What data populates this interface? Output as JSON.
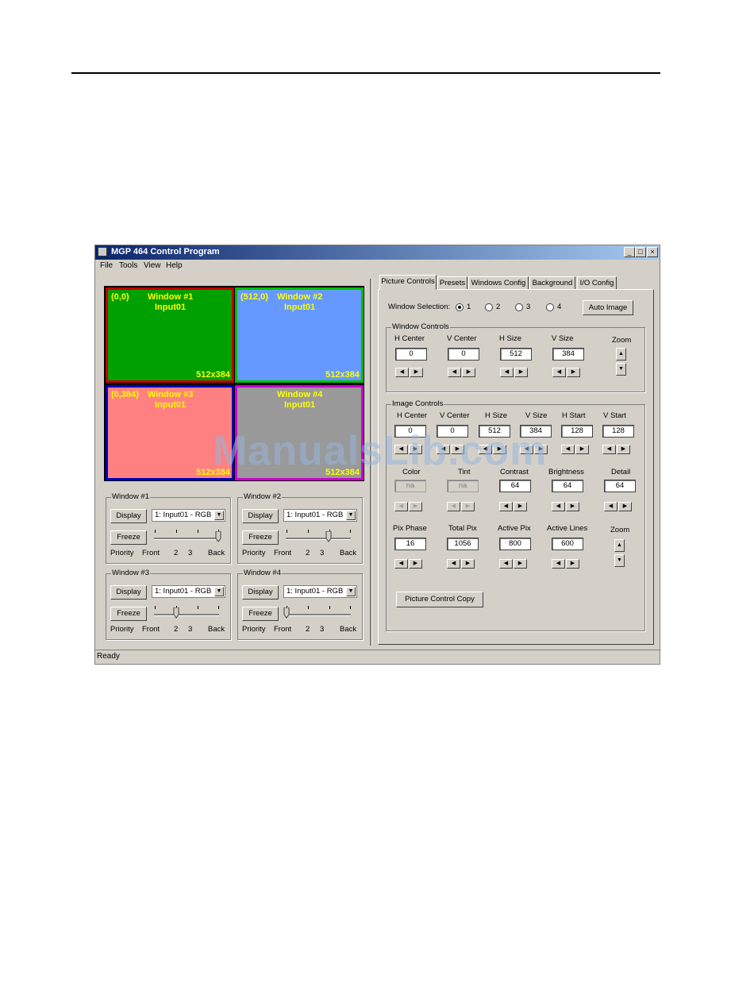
{
  "window": {
    "title": "MGP 464 Control Program",
    "controls": {
      "minimize": "_",
      "maximize": "□",
      "close": "×"
    }
  },
  "menu": [
    "File",
    "Tools",
    "View",
    "Help"
  ],
  "preview": {
    "panes": [
      {
        "coord": "(0,0)",
        "title": "Window #1",
        "input": "Input01",
        "size": "512x384",
        "fill": "#00a000",
        "border": "#c00000"
      },
      {
        "coord": "(512,0)",
        "title": "Window #2",
        "input": "Input01",
        "size": "512x384",
        "fill": "#6699ff",
        "border": "#00c000"
      },
      {
        "coord": "(0,384)",
        "title": "Window #3",
        "input": "Input01",
        "size": "512x384",
        "fill": "#ff8080",
        "border": "#0000c0"
      },
      {
        "coord": "",
        "title": "Window #4",
        "input": "Input01",
        "size": "512x384",
        "fill": "#999999",
        "border": "#cc00cc"
      }
    ]
  },
  "window_groups": [
    {
      "label": "Window #1",
      "display": "Display",
      "combo": "1: Input01 - RGB",
      "freeze": "Freeze",
      "priority": "Priority",
      "front": "Front",
      "p2": "2",
      "p3": "3",
      "back": "Back",
      "priority_level": 4
    },
    {
      "label": "Window #2",
      "display": "Display",
      "combo": "1: Input01 - RGB",
      "freeze": "Freeze",
      "priority": "Priority",
      "front": "Front",
      "p2": "2",
      "p3": "3",
      "back": "Back",
      "priority_level": 3
    },
    {
      "label": "Window #3",
      "display": "Display",
      "combo": "1: Input01 - RGB",
      "freeze": "Freeze",
      "priority": "Priority",
      "front": "Front",
      "p2": "2",
      "p3": "3",
      "back": "Back",
      "priority_level": 2
    },
    {
      "label": "Window #4",
      "display": "Display",
      "combo": "1: Input01 - RGB",
      "freeze": "Freeze",
      "priority": "Priority",
      "front": "Front",
      "p2": "2",
      "p3": "3",
      "back": "Back",
      "priority_level": 1
    }
  ],
  "tabs": [
    "Picture Controls",
    "Presets",
    "Windows Config",
    "Background",
    "I/O Config"
  ],
  "window_selection": {
    "label": "Window Selection:",
    "options": [
      "1",
      "2",
      "3",
      "4"
    ],
    "selected": "1",
    "auto_image": "Auto Image"
  },
  "window_controls": {
    "label": "Window Controls",
    "fields": [
      {
        "label": "H Center",
        "value": "0"
      },
      {
        "label": "V Center",
        "value": "0"
      },
      {
        "label": "H Size",
        "value": "512"
      },
      {
        "label": "V Size",
        "value": "384"
      }
    ],
    "zoom": "Zoom"
  },
  "image_controls": {
    "label": "Image Controls",
    "row1": [
      {
        "label": "H Center",
        "value": "0"
      },
      {
        "label": "V Center",
        "value": "0"
      },
      {
        "label": "H Size",
        "value": "512"
      },
      {
        "label": "V Size",
        "value": "384"
      },
      {
        "label": "H Start",
        "value": "128"
      },
      {
        "label": "V Start",
        "value": "128"
      }
    ],
    "row2": [
      {
        "label": "Color",
        "value": "na"
      },
      {
        "label": "Tint",
        "value": "na"
      },
      {
        "label": "Contrast",
        "value": "64"
      },
      {
        "label": "Brightness",
        "value": "64"
      },
      {
        "label": "Detail",
        "value": "64"
      }
    ],
    "row3": [
      {
        "label": "Pix Phase",
        "value": "16"
      },
      {
        "label": "Total Pix",
        "value": "1056"
      },
      {
        "label": "Active Pix",
        "value": "800"
      },
      {
        "label": "Active Lines",
        "value": "600"
      }
    ],
    "zoom": "Zoom",
    "copy_button": "Picture Control Copy"
  },
  "status": "Ready",
  "watermark": "ManualsLib.com"
}
